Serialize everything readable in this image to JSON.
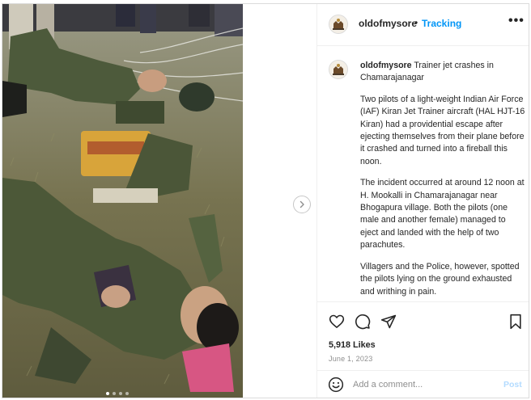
{
  "header": {
    "username": "oldofmysore",
    "separator": "•",
    "follow_label": "Tracking",
    "more_label": "•••"
  },
  "caption": {
    "username": "oldofmysore",
    "title": " Trainer jet crashes in Chamarajanagar",
    "paragraphs": [
      "Two pilots of a light-weight Indian Air Force (IAF) Kiran Jet Trainer aircraft (HAL HJT-16 Kiran) had a providential escape after ejecting themselves from their plane before it crashed and turned into a fireball this noon.",
      "The incident occurred at around 12 noon at H. Mookalli in Chamarajanagar near Bhogapura village. Both the pilots (one male and another female) managed to eject and landed with the help of two parachutes.",
      "Villagers and the Police, however, spotted the pilots lying on the ground exhausted and writhing in pain."
    ]
  },
  "actions": {
    "like_icon": "heart-icon",
    "comment_icon": "comment-icon",
    "share_icon": "send-icon",
    "save_icon": "bookmark-icon"
  },
  "likes_text": "5,918 Likes",
  "date_text": "June 1, 2023",
  "comment": {
    "placeholder": "Add a comment...",
    "post_label": "Post"
  },
  "carousel": {
    "slide_count": 4,
    "active_index": 0
  },
  "colors": {
    "accent": "#0095f6",
    "post_disabled": "#b3dbff",
    "border": "#dbdbdb"
  }
}
